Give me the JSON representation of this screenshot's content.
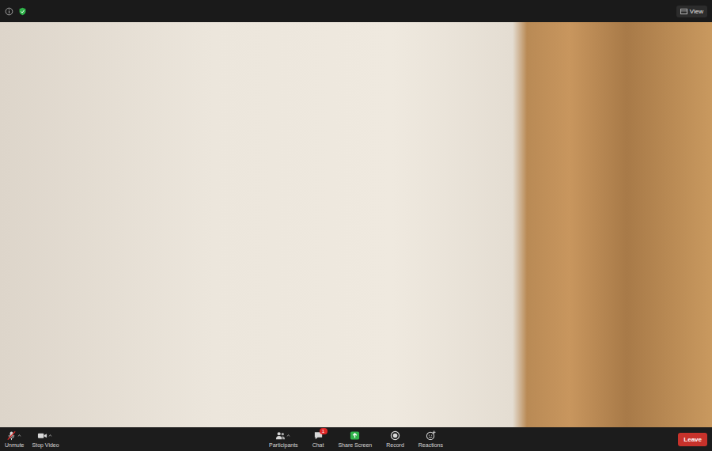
{
  "top_bar": {
    "view_button": {
      "label": "View"
    }
  },
  "toolbar": {
    "left": [
      {
        "label": "Unmute",
        "kind": "mic",
        "muted": true
      },
      {
        "label": "Stop Video",
        "kind": "video"
      }
    ],
    "center": [
      {
        "label": "Participants",
        "kind": "participants"
      },
      {
        "label": "Chat",
        "kind": "chat",
        "badge": "1"
      },
      {
        "label": "Share Screen",
        "kind": "share"
      },
      {
        "label": "Record",
        "kind": "record"
      },
      {
        "label": "Reactions",
        "kind": "reactions"
      }
    ],
    "leave": {
      "label": "Leave"
    }
  }
}
